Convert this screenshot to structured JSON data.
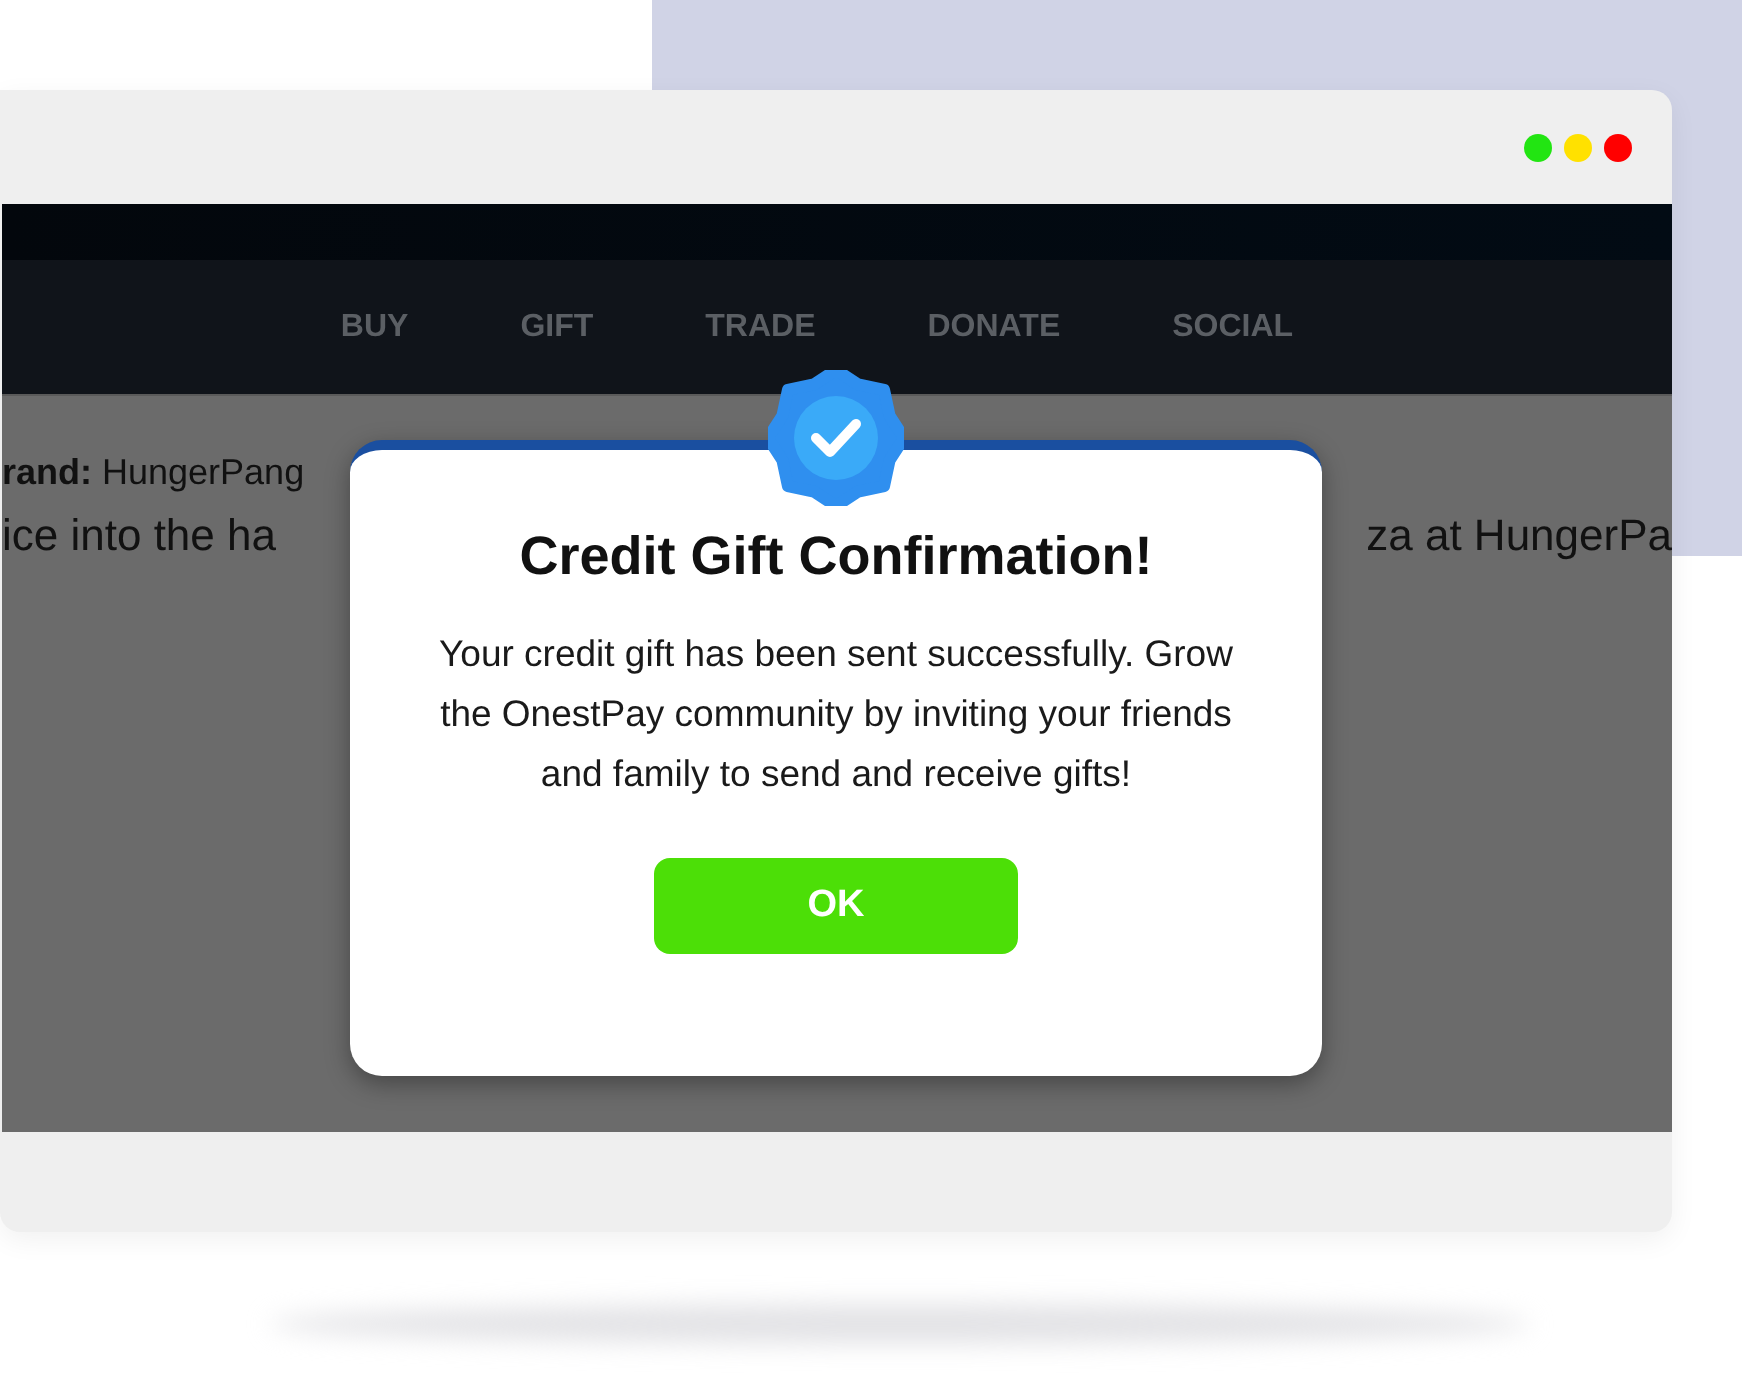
{
  "window": {
    "controls": [
      {
        "color": "#22e512"
      },
      {
        "color": "#ffe100"
      },
      {
        "color": "#ff0000"
      }
    ]
  },
  "nav": {
    "items": [
      "BUY",
      "GIFT",
      "TRADE",
      "DONATE",
      "SOCIAL"
    ]
  },
  "content": {
    "brand_label": "rand:",
    "brand_value": "HungerPang",
    "line_left": "ice into the ha",
    "line_right": "za at HungerPa"
  },
  "modal": {
    "title": "Credit Gift Confirmation!",
    "message": "Your credit gift has been sent successfully. Grow the OnestPay community by inviting your friends and family to send and receive gifts!",
    "button": "OK"
  }
}
